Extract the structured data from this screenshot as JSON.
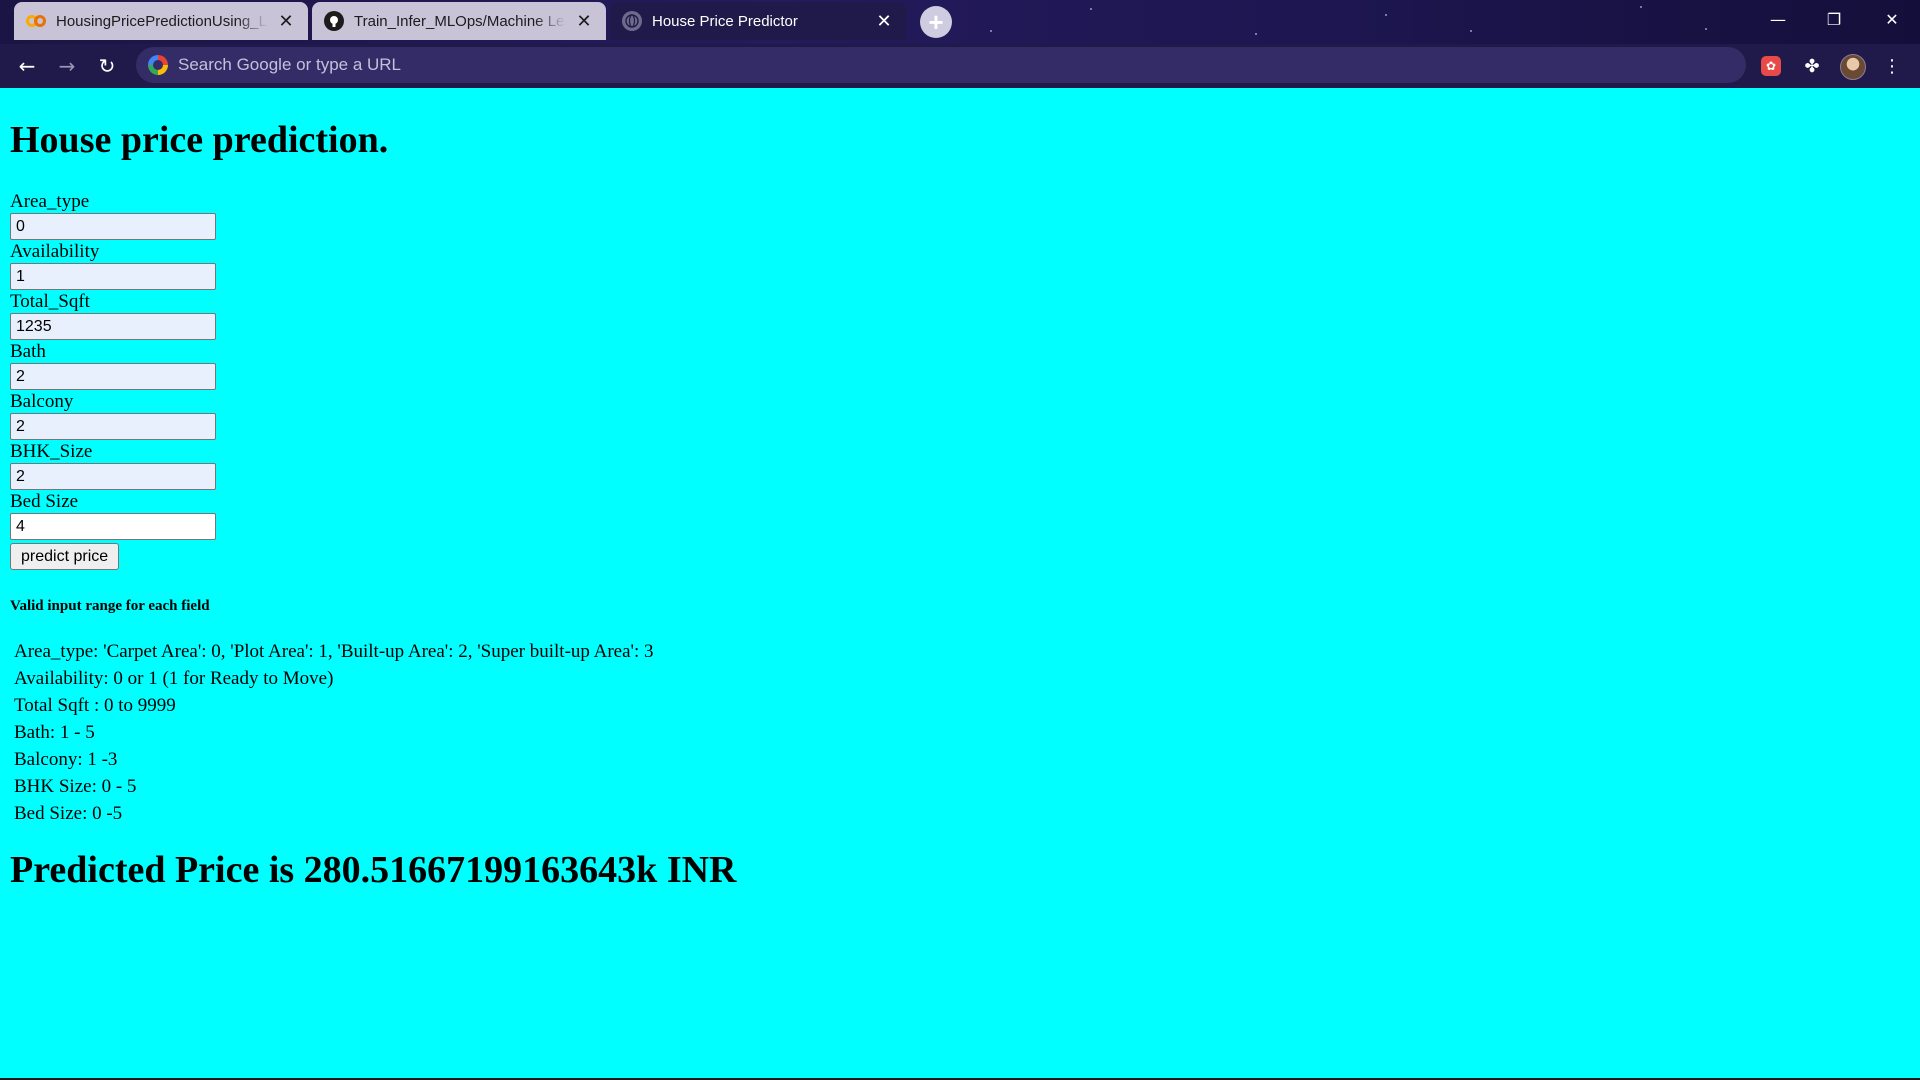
{
  "browser": {
    "tabs": [
      {
        "title": "HousingPricePredictionUsing_Lin",
        "icon": "colab-icon",
        "active": false
      },
      {
        "title": "Train_Infer_MLOps/Machine Lear",
        "icon": "github-icon",
        "active": false
      },
      {
        "title": "House Price Predictor",
        "icon": "globe-icon",
        "active": true
      }
    ],
    "omnibox_placeholder": "Search Google or type a URL"
  },
  "page": {
    "heading": "House price prediction.",
    "fields": [
      {
        "label": "Area_type",
        "value": "0"
      },
      {
        "label": "Availability",
        "value": "1"
      },
      {
        "label": "Total_Sqft",
        "value": "1235"
      },
      {
        "label": "Bath",
        "value": "2"
      },
      {
        "label": "Balcony",
        "value": "2"
      },
      {
        "label": "BHK_Size",
        "value": "2"
      },
      {
        "label": "Bed Size",
        "value": "4"
      }
    ],
    "predict_button": "predict price",
    "range_title": "Valid input range for each field",
    "ranges": [
      "Area_type: 'Carpet Area': 0, 'Plot Area': 1, 'Built-up Area': 2, 'Super built-up Area': 3",
      "Availability: 0 or 1 (1 for Ready to Move)",
      "Total Sqft : 0 to 9999",
      "Bath: 1 - 5",
      "Balcony: 1 -3",
      "BHK Size: 0 - 5",
      "Bed Size: 0 -5"
    ],
    "result": "Predicted Price is 280.51667199163643k INR"
  },
  "colors": {
    "page_background": "#00ffff",
    "chrome_background": "#1f1a4a"
  }
}
